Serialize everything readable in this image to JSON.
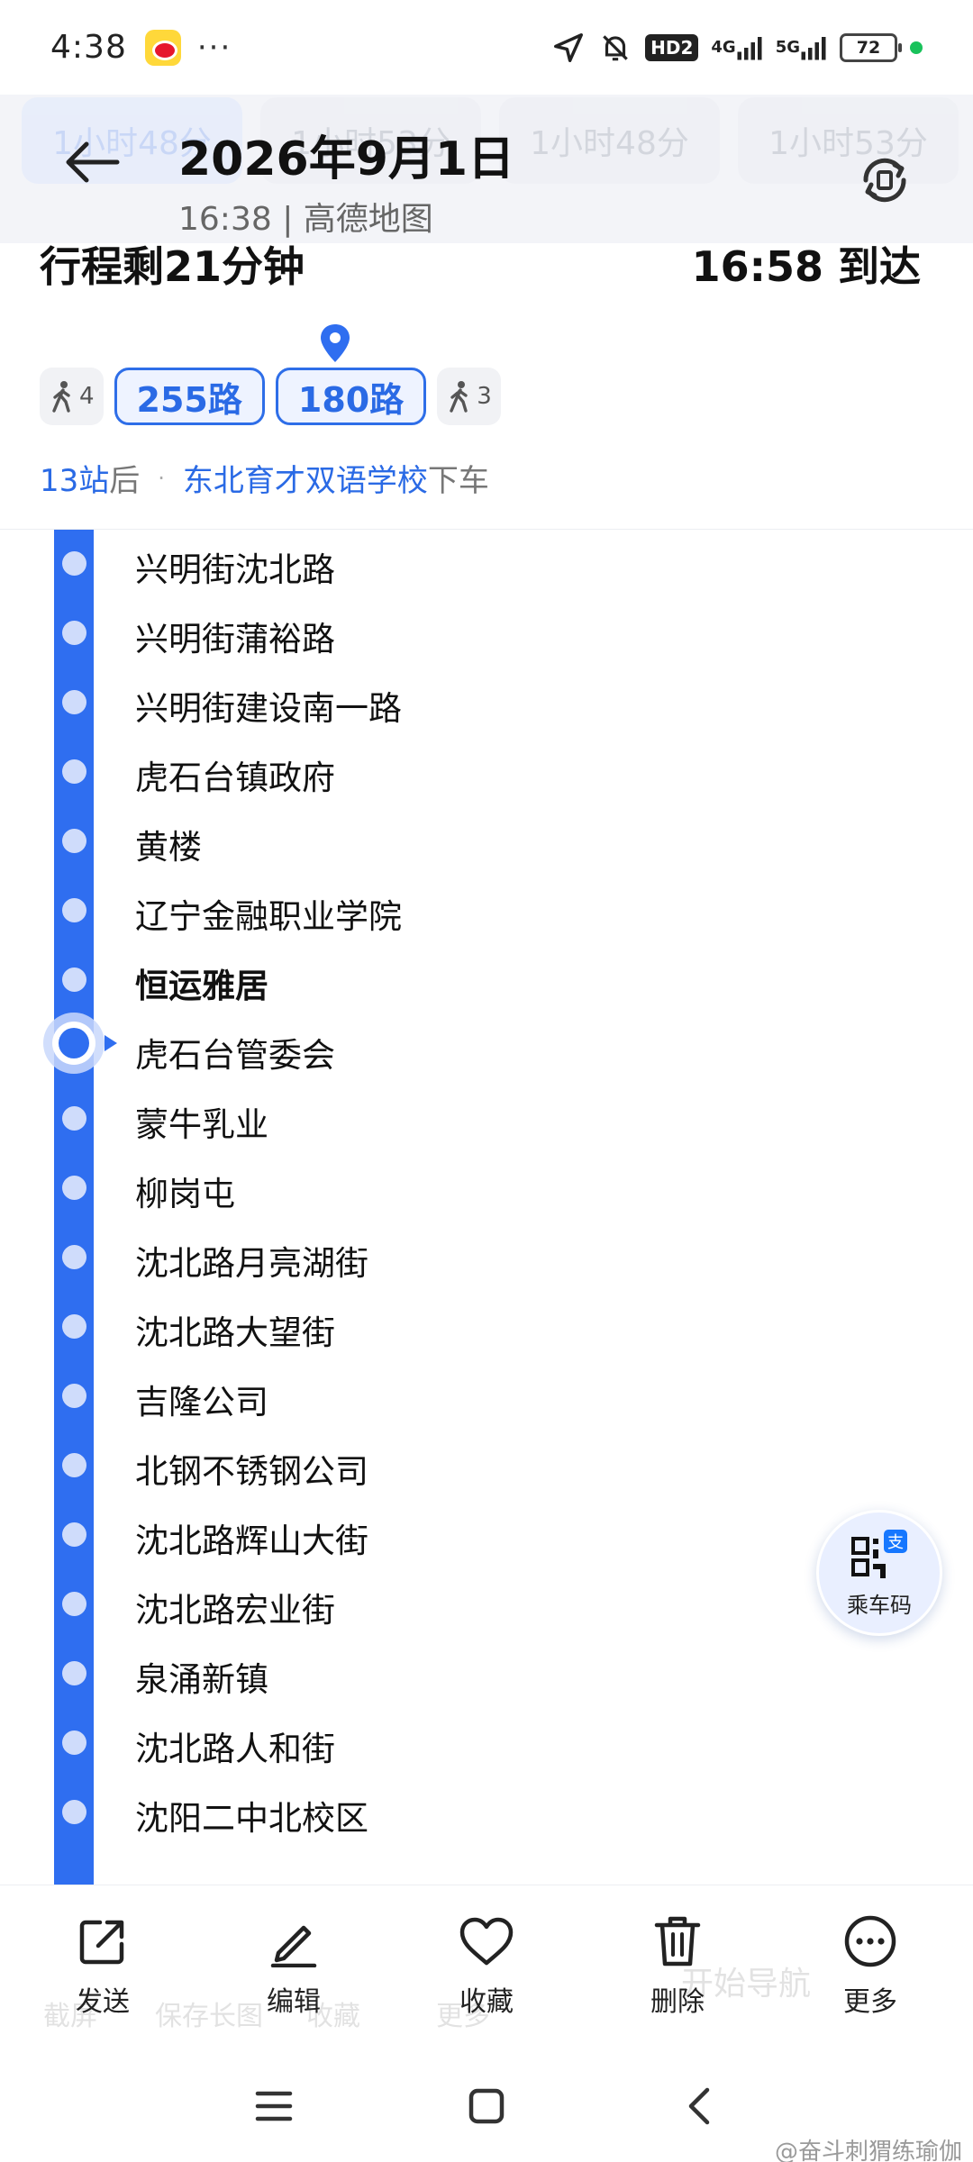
{
  "status_bar": {
    "time": "4:38",
    "dots": "···",
    "hd_label": "HD2",
    "net_4g": "4G",
    "net_5g": "5G",
    "battery": "72"
  },
  "ghost_tabs": [
    "1小时48分",
    "1小时53分",
    "1小时48分",
    "1小时53分"
  ],
  "header": {
    "title": "2026年9月1日",
    "subtitle": "16:38 | 高德地图"
  },
  "journey": {
    "remaining": "行程剩21分钟",
    "arrival": "16:58 到达",
    "walk_before": "4",
    "routes": [
      "255路",
      "180路"
    ],
    "walk_after": "3",
    "stops_until_alight": "13站",
    "after_label": "后",
    "alight_stop": "东北育才双语学校",
    "alight_label": "下车"
  },
  "stops": [
    {
      "name": "兴明街沈北路"
    },
    {
      "name": "兴明街蒲裕路"
    },
    {
      "name": "兴明街建设南一路"
    },
    {
      "name": "虎石台镇政府"
    },
    {
      "name": "黄楼"
    },
    {
      "name": "辽宁金融职业学院"
    },
    {
      "name": "恒运雅居",
      "current": true
    },
    {
      "name": "虎石台管委会"
    },
    {
      "name": "蒙牛乳业"
    },
    {
      "name": "柳岗屯"
    },
    {
      "name": "沈北路月亮湖街"
    },
    {
      "name": "沈北路大望街"
    },
    {
      "name": "吉隆公司"
    },
    {
      "name": "北钢不锈钢公司"
    },
    {
      "name": "沈北路辉山大街"
    },
    {
      "name": "沈北路宏业街"
    },
    {
      "name": "泉涌新镇"
    },
    {
      "name": "沈北路人和街"
    },
    {
      "name": "沈阳二中北校区"
    }
  ],
  "qr": {
    "label": "乘车码",
    "badge": "支"
  },
  "ghost_actions": [
    "截屏",
    "保存长图",
    "收藏",
    "更多",
    "开始导航"
  ],
  "actions": {
    "send": "发送",
    "edit": "编辑",
    "favorite": "收藏",
    "delete": "删除",
    "more": "更多"
  },
  "watermark": "@奋斗刺猬练瑜伽",
  "colors": {
    "accent": "#2f6ef0",
    "route_text": "#2a6ae5",
    "stop_dot": "#cfdcfb"
  }
}
